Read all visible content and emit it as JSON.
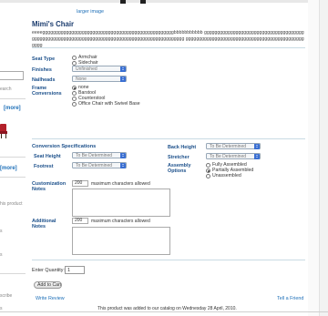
{
  "left": {
    "search_label": "earch",
    "more_link_1": "[more]",
    "more_link_2": "[more]",
    "product_snippet": "his product",
    "misc_1": "s",
    "misc_2": "s",
    "subscribe_snippet": "scribe",
    "misc_3": "s"
  },
  "product": {
    "enlarge_link": "larger image",
    "title": "Mimi's Chair",
    "description": "eeeeggggggggggggggggggggggggggggggggggggggggggggggggggbbbbbbbbbbb gggggggggggggggggggggggggggggggggggggggggggggggggggggggggggggggggggggggggggggggggggggggggggggggg ggggggggggggggggggggggggggggggggggggggggggggggggg"
  },
  "options": {
    "seat_type": {
      "label": "Seat Type",
      "choices": [
        "Armchair",
        "Sidechair"
      ],
      "selected": ""
    },
    "finishes": {
      "label": "Finishes",
      "value": "Unfinished"
    },
    "nailheads": {
      "label": "Nailheads",
      "value": "None"
    },
    "frame_conversions": {
      "label": "Frame Conversions",
      "choices": [
        "none",
        "Barstool",
        "Counterstool",
        "Office Chair with Swivel Base"
      ],
      "selected": "none"
    }
  },
  "conversion": {
    "heading": "Conversion Specifications",
    "seat_height": {
      "label": "Seat Height",
      "value": "To Be Determined"
    },
    "footrest": {
      "label": "Footrest",
      "value": "To Be Determined"
    },
    "back_height": {
      "label": "Back Height",
      "value": "To Be Determined"
    },
    "stretcher": {
      "label": "Stretcher",
      "value": "To Be Determined"
    },
    "assembly": {
      "label": "Assembly Options",
      "choices": [
        "Fully Assembled",
        "Partially Assembled",
        "Unassembled"
      ],
      "selected": "Partially Assembled"
    }
  },
  "notes": {
    "customization": {
      "label": "Customization Notes",
      "max": "200",
      "suffix": "maximum characters allowed"
    },
    "additional": {
      "label": "Additional Notes",
      "max": "200",
      "suffix": "maximum characters allowed"
    }
  },
  "cart": {
    "qty_label": "Enter Quantity:",
    "qty_value": "1",
    "add_button": "Add to Cart"
  },
  "footer": {
    "write_review": "Write Review",
    "tell_friend": "Tell a Friend",
    "added_note": "This product was added to our catalog on Wednesday 28 April, 2010."
  }
}
